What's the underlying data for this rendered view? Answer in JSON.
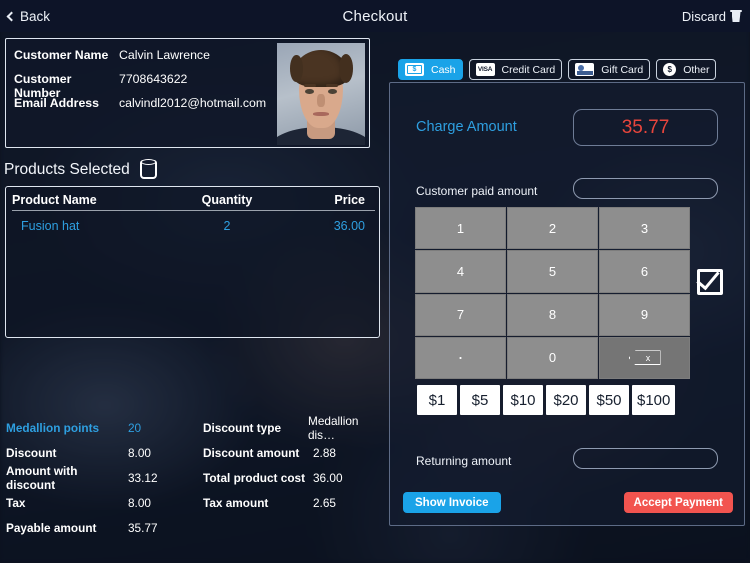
{
  "topbar": {
    "back_label": "Back",
    "title": "Checkout",
    "discard_label": "Discard"
  },
  "customer": {
    "name_label": "Customer Name",
    "name_value": "Calvin Lawrence",
    "number_label": "Customer Number",
    "number_value": "7708643622",
    "email_label": "Email Address",
    "email_value": "calvindl2012@hotmail.com"
  },
  "products": {
    "title": "Products Selected",
    "columns": [
      "Product Name",
      "Quantity",
      "Price"
    ],
    "rows": [
      {
        "name": "Fusion hat",
        "qty": "2",
        "price": "36.00"
      }
    ]
  },
  "summary": {
    "left": [
      {
        "label": "Medallion points",
        "value": "20",
        "highlight": true
      },
      {
        "label": "Discount",
        "value": "8.00",
        "highlight": false
      },
      {
        "label": "Amount with discount",
        "value": "33.12",
        "highlight": false
      },
      {
        "label": "Tax",
        "value": "8.00",
        "highlight": false
      },
      {
        "label": "Payable amount",
        "value": "35.77",
        "highlight": false
      }
    ],
    "right": [
      {
        "label": "Discount type",
        "value": "Medallion dis…"
      },
      {
        "label": "Discount amount",
        "value": "2.88"
      },
      {
        "label": "Total product cost",
        "value": "36.00"
      },
      {
        "label": "Tax amount",
        "value": "2.65"
      }
    ]
  },
  "payment": {
    "tabs": [
      {
        "label": "Cash",
        "icon": "cash-icon",
        "active": true
      },
      {
        "label": "Credit Card",
        "icon": "visa-icon",
        "active": false
      },
      {
        "label": "Gift Card",
        "icon": "gift-card-icon",
        "active": false
      },
      {
        "label": "Other",
        "icon": "dollar-circle-icon",
        "active": false
      }
    ],
    "visa_text": "VISA",
    "other_symbol": "$",
    "cash_symbol": "$",
    "charge_label": "Charge Amount",
    "charge_value": "35.77",
    "paid_label": "Customer paid amount",
    "paid_value": "",
    "paid_placeholder": "",
    "return_label": "Returning amount",
    "return_value": "",
    "return_placeholder": "",
    "keypad": [
      "1",
      "2",
      "3",
      "4",
      "5",
      "6",
      "7",
      "8",
      "9",
      ".",
      "0",
      "DEL"
    ],
    "delete_label": "x",
    "quick_amounts": [
      "$1",
      "$5",
      "$10",
      "$20",
      "$50",
      "$100"
    ],
    "show_invoice_label": "Show Invoice",
    "accept_payment_label": "Accept Payment"
  },
  "colors": {
    "accent_blue": "#2e9fe0",
    "button_blue": "#1aa3e8",
    "charge_red": "#e8453c",
    "accept_red": "#f2544f",
    "panel_bg": "#141d32"
  }
}
